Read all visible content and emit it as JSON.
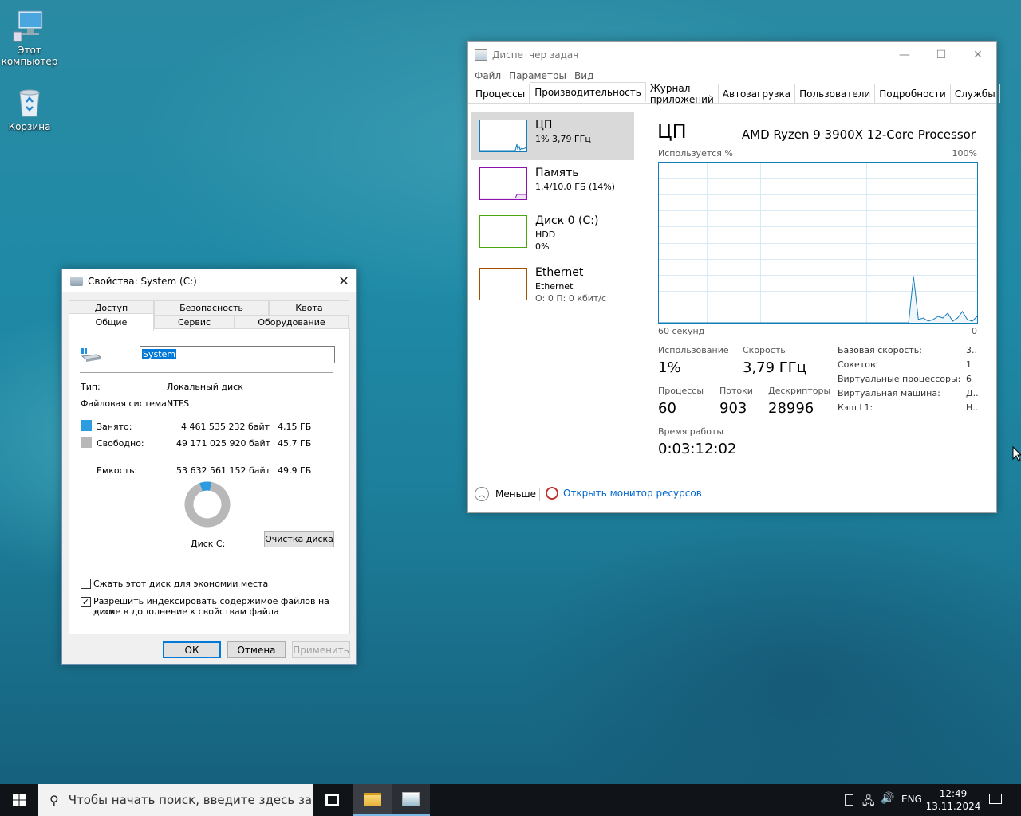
{
  "desktop": {
    "icons": [
      {
        "label": "Этот компьютер"
      },
      {
        "label": "Корзина"
      }
    ]
  },
  "props": {
    "title": "Свойства: System (C:)",
    "tabs_row1": [
      "Доступ",
      "Безопасность",
      "Квота"
    ],
    "tabs_row2": [
      "Общие",
      "Сервис",
      "Оборудование"
    ],
    "name_value": "System",
    "type_label": "Тип:",
    "type_value": "Локальный диск",
    "fs_label": "Файловая система:",
    "fs_value": "NTFS",
    "used_label": "Занято:",
    "used_bytes": "4 461 535 232 байт",
    "used_gb": "4,15 ГБ",
    "free_label": "Свободно:",
    "free_bytes": "49 171 025 920 байт",
    "free_gb": "45,7 ГБ",
    "cap_label": "Емкость:",
    "cap_bytes": "53 632 561 152 байт",
    "cap_gb": "49,9 ГБ",
    "used_fraction": 0.083,
    "disk_label": "Диск C:",
    "cleanup_button": "Очистка диска",
    "compress_label": "Сжать этот диск для экономии места",
    "compress_checked": false,
    "index_label_1": "Разрешить индексировать содержимое файлов на этом",
    "index_label_2": "диске в дополнение к свойствам файла",
    "index_checked": true,
    "ok": "ОК",
    "cancel": "Отмена",
    "apply": "Применить",
    "colors": {
      "used": "#2d9be0",
      "free": "#b8b8b8"
    }
  },
  "tm": {
    "title": "Диспетчер задач",
    "menu": [
      "Файл",
      "Параметры",
      "Вид"
    ],
    "tabs": [
      "Процессы",
      "Производительность",
      "Журнал приложений",
      "Автозагрузка",
      "Пользователи",
      "Подробности",
      "Службы"
    ],
    "selected_tab": 1,
    "side": [
      {
        "name": "ЦП",
        "sub1": "1% 3,79 ГГц",
        "sub2": ""
      },
      {
        "name": "Память",
        "sub1": "1,4/10,0 ГБ (14%)",
        "sub2": ""
      },
      {
        "name": "Диск 0 (C:)",
        "sub1": "HDD",
        "sub2": "0%"
      },
      {
        "name": "Ethernet",
        "sub1": "Ethernet",
        "sub2": "О: 0 П: 0 кбит/с"
      }
    ],
    "heading": "ЦП",
    "processor": "AMD Ryzen 9 3900X 12-Core Processor",
    "graph_label": "Используется %",
    "graph_max": "100%",
    "graph_time": "60 секунд",
    "graph_min": "0",
    "stats": {
      "usage_label": "Использование",
      "usage": "1%",
      "speed_label": "Скорость",
      "speed": "3,79 ГГц",
      "proc_label": "Процессы",
      "proc": "60",
      "threads_label": "Потоки",
      "threads": "903",
      "handles_label": "Дескрипторы",
      "handles": "28996",
      "uptime_label": "Время работы",
      "uptime": "0:03:12:02"
    },
    "right_stats": [
      {
        "label": "Базовая скорость:",
        "value": "3.."
      },
      {
        "label": "Сокетов:",
        "value": "1"
      },
      {
        "label": "Виртуальные процессоры:",
        "value": "6"
      },
      {
        "label": "Виртуальная машина:",
        "value": "Д.."
      },
      {
        "label": "Кэш L1:",
        "value": "Н.."
      }
    ],
    "less_label": "Меньше",
    "monitor_link": "Открыть монитор ресурсов",
    "cpu_history": [
      0,
      0,
      0,
      0,
      0,
      0,
      0,
      0,
      0,
      0,
      0,
      0,
      0,
      0,
      0,
      0,
      0,
      0,
      0,
      0,
      0,
      0,
      0,
      0,
      0,
      0,
      0,
      0,
      0,
      0,
      0,
      0,
      0,
      0,
      0,
      0,
      0,
      0,
      0,
      0,
      0,
      0,
      0,
      0,
      0,
      0,
      0,
      0,
      0,
      0,
      0,
      0,
      29,
      2,
      3,
      1,
      2,
      4,
      3,
      6,
      1,
      3,
      7,
      2,
      1,
      4
    ]
  },
  "taskbar": {
    "search_placeholder": "Чтобы начать поиск, введите здесь запрос",
    "lang": "ENG",
    "time": "12:49",
    "date": "13.11.2024"
  }
}
